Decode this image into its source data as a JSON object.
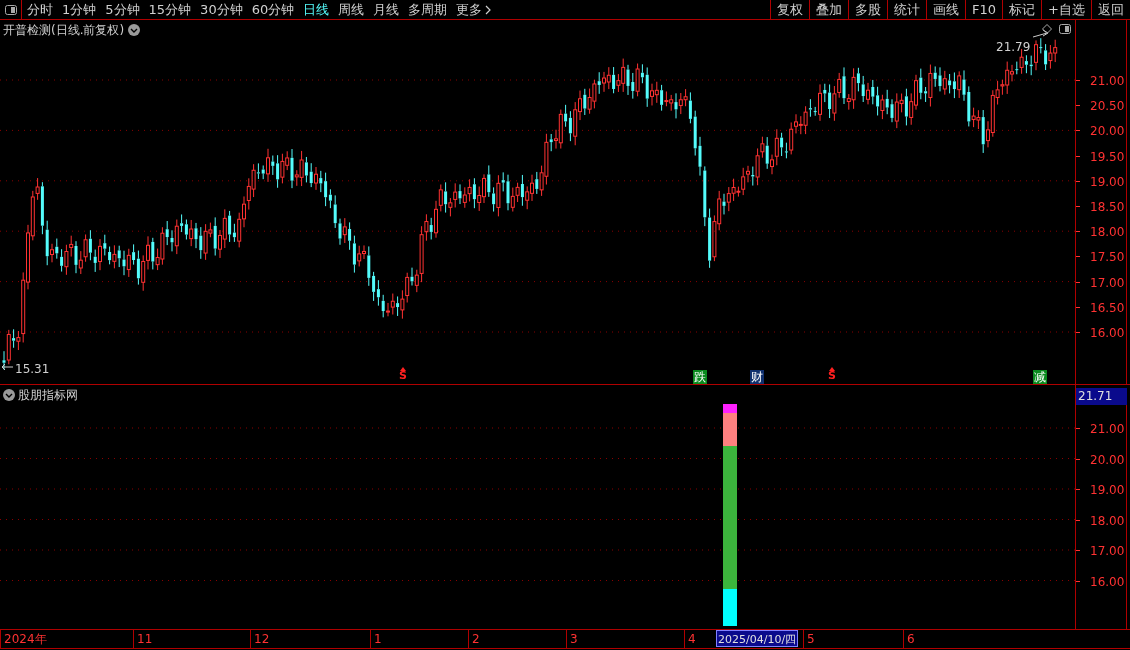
{
  "toolbar": {
    "periods": [
      {
        "label": "分时",
        "selected": false
      },
      {
        "label": "1分钟",
        "selected": false
      },
      {
        "label": "5分钟",
        "selected": false
      },
      {
        "label": "15分钟",
        "selected": false
      },
      {
        "label": "30分钟",
        "selected": false
      },
      {
        "label": "60分钟",
        "selected": false
      },
      {
        "label": "日线",
        "selected": true
      },
      {
        "label": "周线",
        "selected": false
      },
      {
        "label": "月线",
        "selected": false
      },
      {
        "label": "多周期",
        "selected": false
      }
    ],
    "more": "更多",
    "actions": [
      "复权",
      "叠加",
      "多股",
      "统计",
      "画线",
      "F10",
      "标记",
      "+自选",
      "返回"
    ]
  },
  "main_chart": {
    "title": "开普检测(日线.前复权)",
    "high_label": "21.79",
    "low_label": "15.31",
    "y_axis": [
      "21.00",
      "20.50",
      "20.00",
      "19.50",
      "19.00",
      "18.50",
      "18.00",
      "17.50",
      "17.00",
      "16.50",
      "16.00"
    ],
    "markers": [
      {
        "kind": "signal",
        "text": "S",
        "color": "#ff2020"
      },
      {
        "kind": "tag",
        "text": "跌",
        "color": "#0a8a1e"
      },
      {
        "kind": "tag",
        "text": "财",
        "color": "#10306e"
      },
      {
        "kind": "signal",
        "text": "S",
        "color": "#ff2020"
      },
      {
        "kind": "tag",
        "text": "减",
        "color": "#0a8a1e"
      }
    ]
  },
  "indicator_panel": {
    "title": "股朋指标网",
    "current_value": "21.71",
    "y_axis": [
      "21.00",
      "20.00",
      "19.00",
      "18.00",
      "17.00",
      "16.00"
    ]
  },
  "time_axis": {
    "labels": [
      {
        "text": "2024年",
        "kind": "month"
      },
      {
        "text": "11",
        "kind": "month"
      },
      {
        "text": "12",
        "kind": "month"
      },
      {
        "text": "1",
        "kind": "month"
      },
      {
        "text": "2",
        "kind": "month"
      },
      {
        "text": "3",
        "kind": "month"
      },
      {
        "text": "4",
        "kind": "month"
      },
      {
        "text": "2025/04/10/四",
        "kind": "cursor"
      },
      {
        "text": "5",
        "kind": "month"
      },
      {
        "text": "6",
        "kind": "month"
      }
    ]
  }
}
